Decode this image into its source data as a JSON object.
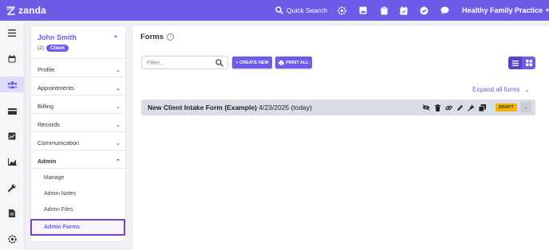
{
  "app": {
    "name": "zanda"
  },
  "topbar": {
    "quick_search": "Quick Search",
    "practice": "Healthy Family Practice",
    "icons": [
      "gear-icon",
      "image-icon",
      "clipboard-icon",
      "calendar-check-icon",
      "check-circle-icon",
      "chat-icon"
    ]
  },
  "rail": {
    "items": [
      "menu-icon",
      "calendar-icon",
      "clients-icon",
      "billing-card-icon",
      "reports-icon",
      "chart-icon",
      "wrench-icon",
      "document-icon",
      "settings-icon"
    ],
    "active": "clients-icon"
  },
  "patient": {
    "name": "John Smith",
    "count": "(2)",
    "badge": "Client",
    "menu": [
      {
        "label": "Profile"
      },
      {
        "label": "Appointments"
      },
      {
        "label": "Billing"
      },
      {
        "label": "Records"
      },
      {
        "label": "Communication"
      },
      {
        "label": "Admin"
      }
    ],
    "admin_sub": [
      {
        "label": "Manage"
      },
      {
        "label": "Admin Notes"
      },
      {
        "label": "Admin Files"
      },
      {
        "label": "Admin Forms"
      }
    ],
    "active_sub": "Admin Forms"
  },
  "main": {
    "title": "Forms",
    "info": "i",
    "filter_placeholder": "Filter...",
    "create_new": "+ CREATE NEW",
    "print_all": "PRINT ALL",
    "expand_all": "Expand all forms",
    "forms": [
      {
        "name": "New Client Intake Form (Example)",
        "date": "4/23/2025 (today)",
        "status": "DRAFT"
      }
    ]
  },
  "colors": {
    "brand": "#6c5ce7",
    "draft": "#f4b400",
    "active_outline": "#7b3fc9"
  }
}
